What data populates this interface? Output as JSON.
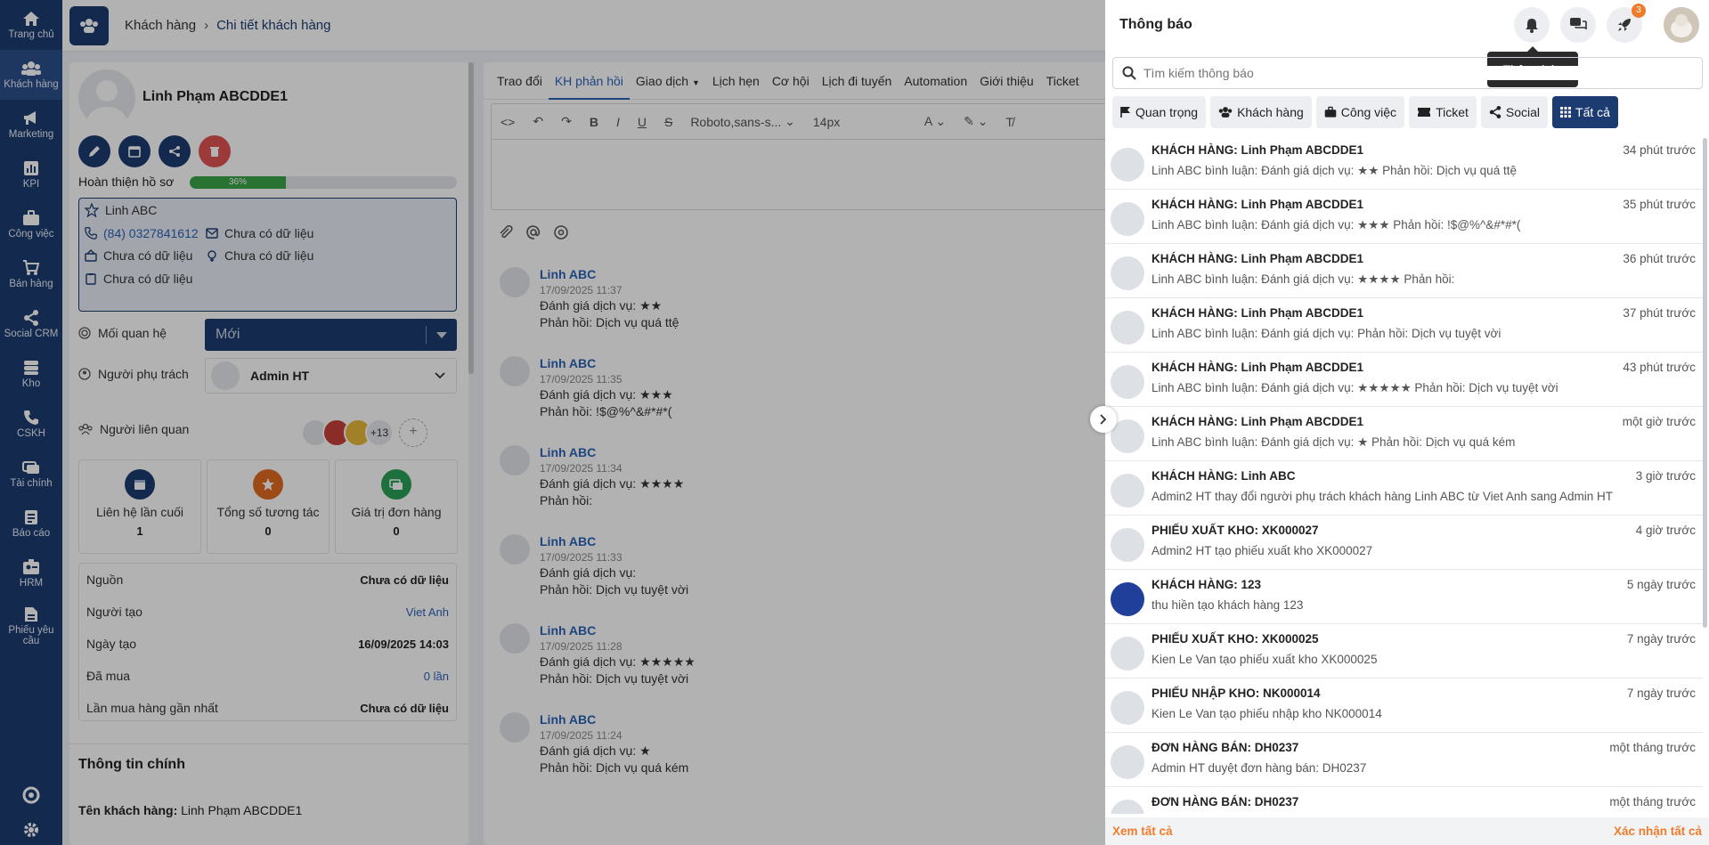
{
  "sidebar": {
    "items": [
      {
        "label": "Trang chủ",
        "icon": "home-icon"
      },
      {
        "label": "Khách hàng",
        "icon": "users-icon"
      },
      {
        "label": "Marketing",
        "icon": "megaphone-icon"
      },
      {
        "label": "KPI",
        "icon": "chart-icon"
      },
      {
        "label": "Công việc",
        "icon": "briefcase-icon"
      },
      {
        "label": "Bán hàng",
        "icon": "cart-icon"
      },
      {
        "label": "Social CRM",
        "icon": "share-icon"
      },
      {
        "label": "Kho",
        "icon": "warehouse-icon"
      },
      {
        "label": "CSKH",
        "icon": "phone-icon"
      },
      {
        "label": "Tài chính",
        "icon": "money-icon"
      },
      {
        "label": "Báo cáo",
        "icon": "report-icon"
      },
      {
        "label": "HRM",
        "icon": "id-card-icon"
      },
      {
        "label": "Phiếu yêu cầu",
        "icon": "document-icon"
      }
    ]
  },
  "breadcrumb": {
    "parent": "Khách hàng",
    "current": "Chi tiết khách hàng"
  },
  "customer": {
    "name": "Linh Phạm ABCDDE1",
    "progress_label": "Hoàn thiện hồ sơ",
    "progress_text": "36%",
    "progress_value": 0.36,
    "contact_name": "Linh ABC",
    "phone": "(84) 0327841612",
    "email": "Chưa có dữ liệu",
    "company": "Chưa có dữ liệu",
    "gender": "Chưa có dữ liệu",
    "note": "Chưa có dữ liệu",
    "relation_label": "Mối quan hệ",
    "relation_value": "Mới",
    "owner_label": "Người phụ trách",
    "owner_value": "Admin HT",
    "related_label": "Người liên quan",
    "related_more": "+13"
  },
  "stats": [
    {
      "label": "Liên hệ lần cuối",
      "value": "1"
    },
    {
      "label": "Tổng số tương tác",
      "value": "0"
    },
    {
      "label": "Giá trị đơn hàng",
      "value": "0"
    }
  ],
  "details": [
    {
      "key": "Nguồn",
      "value": "Chưa có dữ liệu"
    },
    {
      "key": "Người tạo",
      "value": "Viet Anh"
    },
    {
      "key": "Ngày tạo",
      "value": "16/09/2025 14:03"
    },
    {
      "key": "Đã mua",
      "value": "0 lần"
    },
    {
      "key": "Lần mua hàng gần nhất",
      "value": "Chưa có dữ liệu"
    }
  ],
  "main_info": {
    "title": "Thông tin chính",
    "name_label": "Tên khách hàng:",
    "name_value": "Linh Phạm ABCDDE1"
  },
  "tabs": [
    "Trao đổi",
    "KH phản hồi",
    "Giao dịch",
    "Lịch hẹn",
    "Cơ hội",
    "Lịch đi tuyến",
    "Automation",
    "Giới thiệu",
    "Ticket"
  ],
  "editor": {
    "font": "Roboto,sans-s...",
    "size": "14px"
  },
  "comments": [
    {
      "name": "Linh ABC",
      "time": "17/09/2025 11:37",
      "line1": "Đánh giá dịch vụ: ★★",
      "line2": "Phản hồi: Dịch vụ quá ttệ"
    },
    {
      "name": "Linh ABC",
      "time": "17/09/2025 11:35",
      "line1": "Đánh giá dịch vụ: ★★★",
      "line2": "Phản hồi: !$@%^&#*#*("
    },
    {
      "name": "Linh ABC",
      "time": "17/09/2025 11:34",
      "line1": "Đánh giá dịch vụ: ★★★★",
      "line2": "Phản hồi:"
    },
    {
      "name": "Linh ABC",
      "time": "17/09/2025 11:33",
      "line1": "Đánh giá dịch vụ:",
      "line2": "Phản hồi: Dịch vụ tuyệt vời"
    },
    {
      "name": "Linh ABC",
      "time": "17/09/2025 11:28",
      "line1": "Đánh giá dịch vụ: ★★★★★",
      "line2": "Phản hồi: Dịch vụ tuyệt vời"
    },
    {
      "name": "Linh ABC",
      "time": "17/09/2025 11:24",
      "line1": "Đánh giá dịch vụ: ★",
      "line2": "Phản hồi: Dịch vụ quá kém"
    }
  ],
  "notifications": {
    "title": "Thông báo",
    "tooltip": "Thông báo",
    "rocket_badge": "3",
    "search_placeholder": "Tìm kiếm thông báo",
    "filters": [
      "Quan trọng",
      "Khách hàng",
      "Công việc",
      "Ticket",
      "Social",
      "Tất cả"
    ],
    "items": [
      {
        "title": "KHÁCH HÀNG: Linh Phạm ABCDDE1",
        "time": "34 phút trước",
        "body": "Linh ABC bình luận: Đánh giá dịch vụ: ★★ Phản hồi: Dịch vụ quá ttệ"
      },
      {
        "title": "KHÁCH HÀNG: Linh Phạm ABCDDE1",
        "time": "35 phút trước",
        "body": "Linh ABC bình luận: Đánh giá dịch vụ: ★★★ Phản hồi: !$@%^&#*#*("
      },
      {
        "title": "KHÁCH HÀNG: Linh Phạm ABCDDE1",
        "time": "36 phút trước",
        "body": "Linh ABC bình luận: Đánh giá dịch vụ: ★★★★ Phản hồi:"
      },
      {
        "title": "KHÁCH HÀNG: Linh Phạm ABCDDE1",
        "time": "37 phút trước",
        "body": "Linh ABC bình luận: Đánh giá dịch vụ: Phản hồi: Dịch vụ tuyệt vời"
      },
      {
        "title": "KHÁCH HÀNG: Linh Phạm ABCDDE1",
        "time": "43 phút trước",
        "body": "Linh ABC bình luận: Đánh giá dịch vụ: ★★★★★ Phản hồi: Dịch vụ tuyệt vời"
      },
      {
        "title": "KHÁCH HÀNG: Linh Phạm ABCDDE1",
        "time": "một giờ trước",
        "body": "Linh ABC bình luận: Đánh giá dịch vụ: ★ Phản hồi: Dịch vụ quá kém"
      },
      {
        "title": "KHÁCH HÀNG: Linh ABC",
        "time": "3 giờ trước",
        "body": "Admin2 HT thay đổi người phụ trách khách hàng Linh ABC từ Viet Anh sang Admin HT"
      },
      {
        "title": "PHIẾU XUẤT KHO: XK000027",
        "time": "4 giờ trước",
        "body": "Admin2 HT tạo phiếu xuất kho XK000027"
      },
      {
        "title": "KHÁCH HÀNG: 123",
        "time": "5 ngày trước",
        "body": "thu hiền tạo khách hàng 123"
      },
      {
        "title": "PHIẾU XUẤT KHO: XK000025",
        "time": "7 ngày trước",
        "body": "Kien Le Van tạo phiếu xuất kho XK000025"
      },
      {
        "title": "PHIẾU NHẬP KHO: NK000014",
        "time": "7 ngày trước",
        "body": "Kien Le Van tạo phiếu nhập kho NK000014"
      },
      {
        "title": "ĐƠN HÀNG BÁN: DH0237",
        "time": "một tháng trước",
        "body": "Admin HT duyệt đơn hàng bán: DH0237"
      },
      {
        "title": "ĐƠN HÀNG BÁN: DH0237",
        "time": "một tháng trước",
        "body": ""
      }
    ],
    "view_all": "Xem tất cả",
    "mark_all": "Xác nhận tất cả"
  },
  "colors": {
    "primary": "#1c3b70",
    "accent": "#f07b2b",
    "link": "#2b63b8",
    "success": "#3aa548",
    "danger": "#e05252"
  }
}
